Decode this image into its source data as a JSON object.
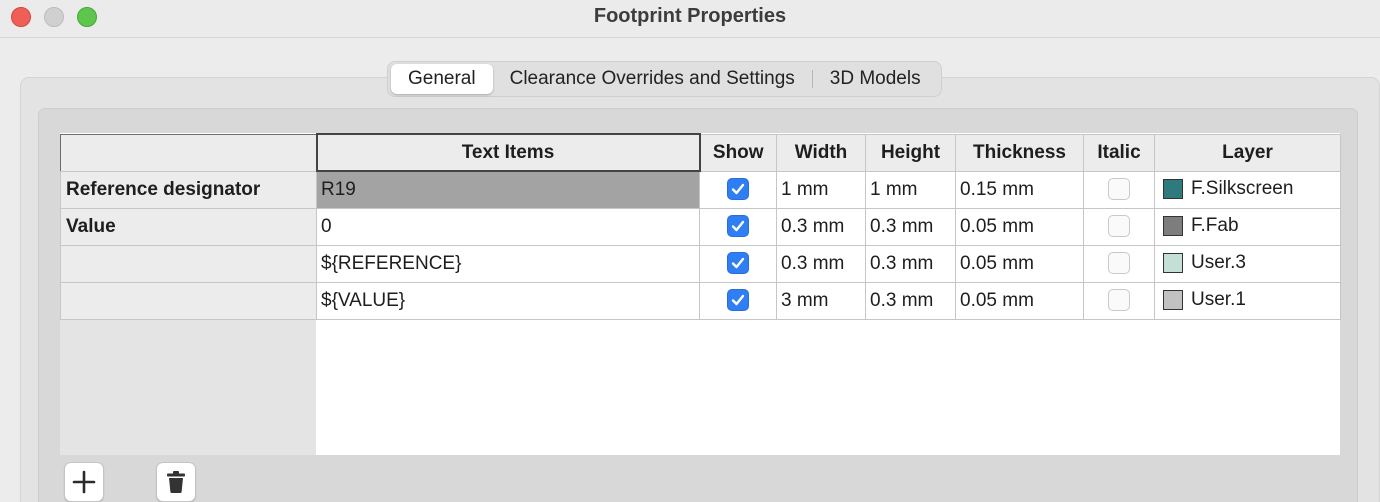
{
  "window": {
    "title": "Footprint Properties"
  },
  "tabs": [
    {
      "label": "General",
      "active": true
    },
    {
      "label": "Clearance Overrides and Settings",
      "active": false
    },
    {
      "label": "3D Models",
      "active": false
    }
  ],
  "grid": {
    "columns": [
      "Text Items",
      "Show",
      "Width",
      "Height",
      "Thickness",
      "Italic",
      "Layer"
    ],
    "rows": [
      {
        "label": "Reference designator",
        "text": "R19",
        "show": true,
        "width": "1 mm",
        "height": "1 mm",
        "thickness": "0.15 mm",
        "italic": false,
        "layer": "F.Silkscreen",
        "layer_color": "#2f7a7d"
      },
      {
        "label": "Value",
        "text": "0",
        "show": true,
        "width": "0.3 mm",
        "height": "0.3 mm",
        "thickness": "0.05 mm",
        "italic": false,
        "layer": "F.Fab",
        "layer_color": "#7d7d7d"
      },
      {
        "label": "",
        "text": "${REFERENCE}",
        "show": true,
        "width": "0.3 mm",
        "height": "0.3 mm",
        "thickness": "0.05 mm",
        "italic": false,
        "layer": "User.3",
        "layer_color": "#c3dfd6"
      },
      {
        "label": "",
        "text": "${VALUE}",
        "show": true,
        "width": "3 mm",
        "height": "0.3 mm",
        "thickness": "0.05 mm",
        "italic": false,
        "layer": "User.1",
        "layer_color": "#c2c2c2"
      }
    ]
  },
  "buttons": {
    "add_icon": "plus-icon",
    "delete_icon": "trash-icon"
  },
  "colors": {
    "checkbox_on": "#2f7ef4",
    "selected_cell": "#a3a3a3"
  }
}
